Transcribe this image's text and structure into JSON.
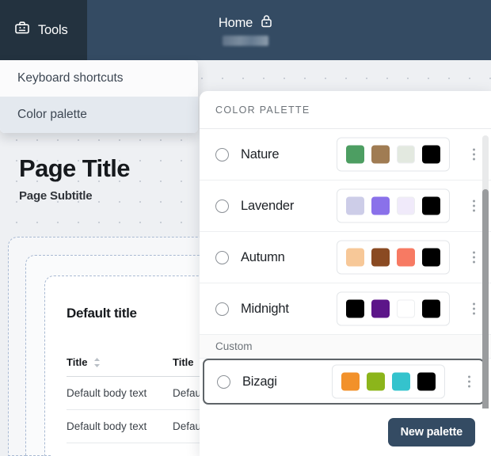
{
  "topbar": {
    "tools_label": "Tools",
    "tools_icon": "toolbox-icon",
    "home_label": "Home",
    "lock_icon": "lock-icon"
  },
  "dropdown": {
    "items": [
      {
        "label": "Keyboard shortcuts",
        "active": false
      },
      {
        "label": "Color palette",
        "active": true
      }
    ]
  },
  "page": {
    "title": "Page Title",
    "subtitle": "Page Subtitle"
  },
  "card": {
    "title": "Default title",
    "columns": [
      "Title",
      "Title"
    ],
    "sort_icon": "sort-chevrons-icon",
    "rows": [
      [
        "Default body text",
        "Default body text"
      ],
      [
        "Default body text",
        "Default body text"
      ]
    ]
  },
  "panel": {
    "header": "COLOR PALETTE",
    "section_label": "Custom",
    "kebab_icon": "more-vertical-icon",
    "new_palette_button": "New palette",
    "palettes": [
      {
        "name": "Nature",
        "selected": false,
        "focused": false,
        "colors": [
          "#4d9e62",
          "#a07c53",
          "#e3e9e0",
          "#000000"
        ]
      },
      {
        "name": "Lavender",
        "selected": false,
        "focused": false,
        "colors": [
          "#cdcde8",
          "#8a71ea",
          "#f0eafa",
          "#000000"
        ]
      },
      {
        "name": "Autumn",
        "selected": false,
        "focused": false,
        "colors": [
          "#f7c898",
          "#8a4a22",
          "#f77a63",
          "#000000"
        ]
      },
      {
        "name": "Midnight",
        "selected": false,
        "focused": false,
        "colors": [
          "#000000",
          "#5c1589",
          "#ffffff",
          "#000000"
        ]
      },
      {
        "name": "Bizagi",
        "selected": false,
        "focused": true,
        "colors": [
          "#f2912a",
          "#8cb51b",
          "#34c3cd",
          "#000000"
        ]
      }
    ]
  },
  "theme": {
    "header_bg": "#344b63",
    "tools_tab_bg": "#23323f",
    "accent": "#344b63",
    "canvas_bg": "#eef0f3"
  }
}
